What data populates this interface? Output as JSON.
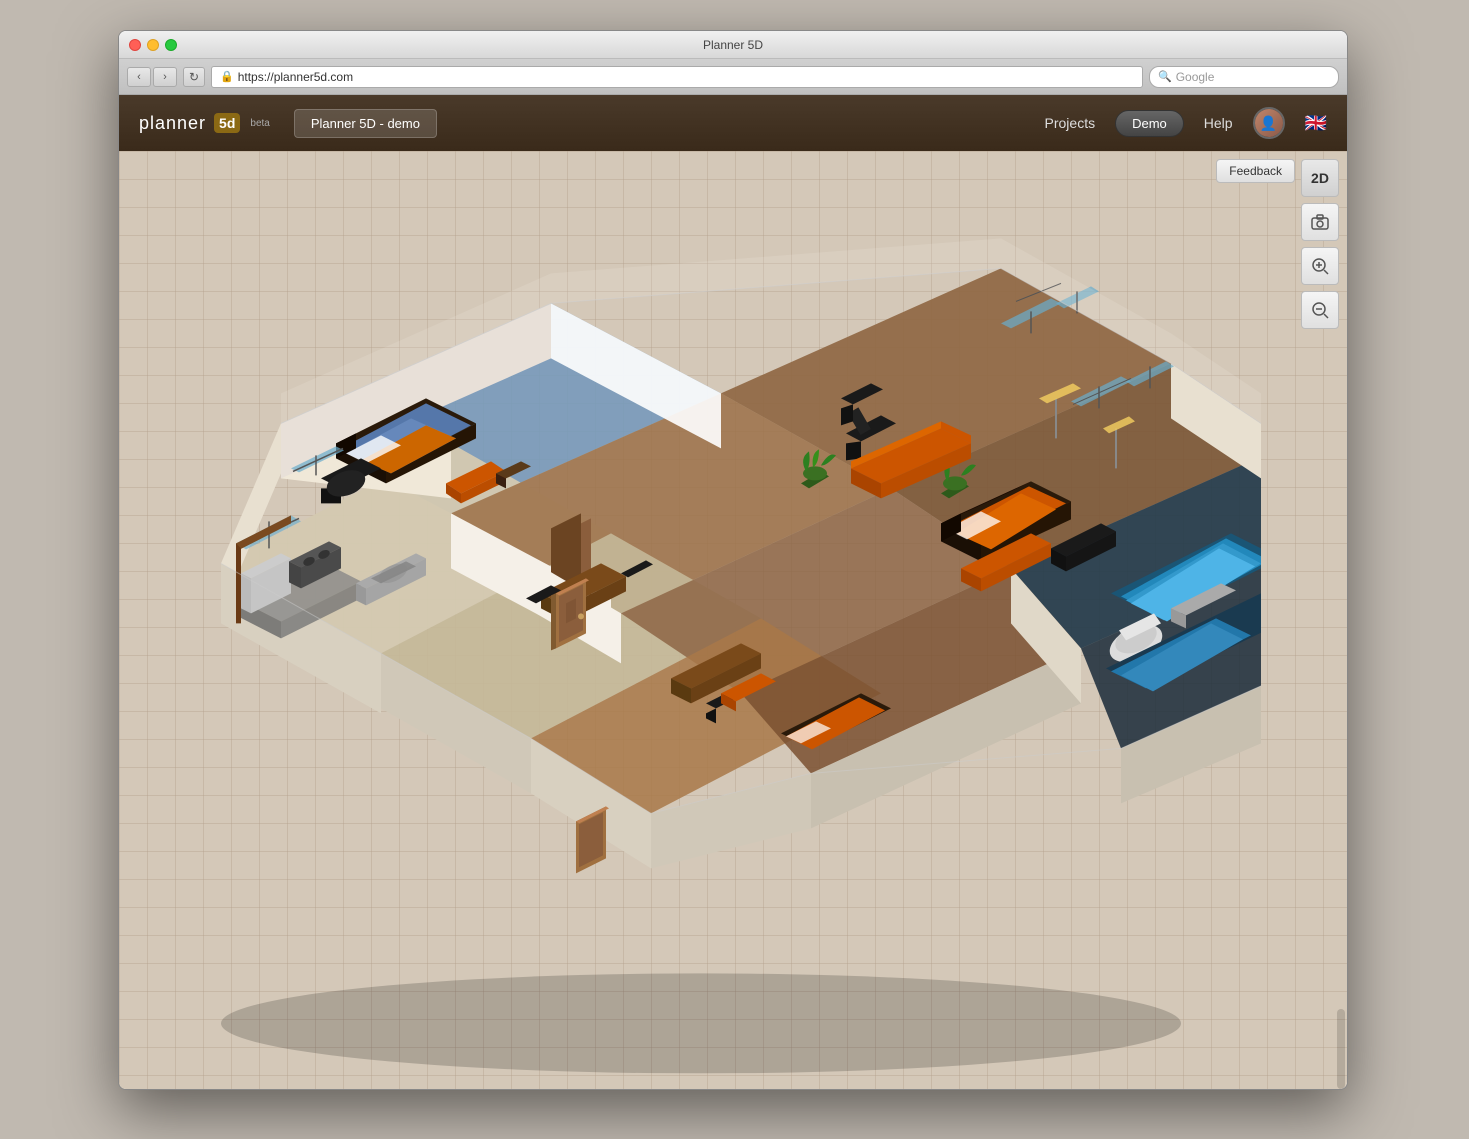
{
  "window": {
    "title": "Planner 5D",
    "url": "https://planner5d.com"
  },
  "browser": {
    "nav_back": "‹",
    "nav_forward": "›",
    "reload": "↻",
    "search_placeholder": "Google"
  },
  "header": {
    "logo_text": "planner",
    "logo_box": "5d",
    "beta": "beta",
    "project_name": "Planner 5D - demo",
    "nav_projects": "Projects",
    "nav_demo": "Demo",
    "nav_help": "Help"
  },
  "toolbar": {
    "feedback_label": "Feedback",
    "btn_2d": "2D",
    "btn_camera": "📷",
    "btn_zoom_in": "⊕",
    "btn_zoom_out": "⊖"
  }
}
